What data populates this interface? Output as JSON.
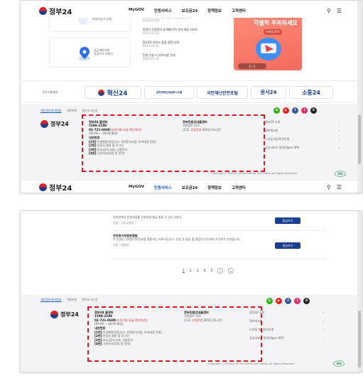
{
  "header": {
    "logo": "정부24",
    "nav": [
      "MyGOV",
      "민원서비스",
      "보조금24",
      "정책정보",
      "고객센터"
    ]
  },
  "top_section": {
    "card1_label": "부동산등기 신청",
    "card2_label": "공공개방자원\n공공누리 서비스",
    "news": [
      {
        "title": "[보건복지부] 아동수당 등 통합신청 안내",
        "date": "2024.10.23"
      },
      {
        "title": "동절기 건강관리 및 예방수칙 안내 제공 서비스",
        "date": "2024.10.22"
      },
      {
        "title": "정부24 서비스 점검 일정 안내",
        "date": "2024.10.21"
      },
      {
        "title": "민원 신청 시 유의사항 안내",
        "date": "2024.10.18"
      }
    ],
    "promo": {
      "headline": "각별히 주의하세요",
      "pill": "스미싱 문자",
      "counter": "2 / 3"
    }
  },
  "banners": {
    "label": "국민소통채널",
    "items": [
      "혁신24",
      "인터넷재산세납부시스템",
      "국민재난안전포털",
      "문서24",
      "소통24"
    ]
  },
  "footer": {
    "tabs": [
      "개인정보처리방침",
      "이용약관",
      "찾아오시는길"
    ],
    "logo": "정부24",
    "left": {
      "title": "정부24 콜센터",
      "phone1": "1588-2188",
      "phone2": "02-721-0600",
      "phone2_note": "(유료이용 요금 확인하기)",
      "hours": "(09:00 ~ 18:00 평일)",
      "guide_title": "내선번호",
      "guide": [
        {
          "key": "[1번]",
          "val": "민원행정(전입신고, 전자문서지갑, 토지대장 민원)"
        },
        {
          "key": "[2번]",
          "val": "인증서 회원 및 로그인"
        },
        {
          "key": "[3번]",
          "val": "보조금24 조회, 신청문의"
        },
        {
          "key": "[4번]",
          "val": "국민비서(알림 및 문의)"
        }
      ]
    },
    "right": {
      "title": "정부민원안내콜센터",
      "phone": "국번없이 110",
      "note_prefix": "(무료, ",
      "note_link": "휴일운영",
      "note_suffix": " 365일 24시간)"
    },
    "links": [
      "정부24 소개",
      "정보게시판",
      "누리집 개선의견신청",
      "공공서비스 정보(Open API)"
    ],
    "copyright": "Copyright ⓒ Ministry of the Interior and Safety. All Rights Reserved.",
    "sns": [
      "b",
      "▶",
      "f",
      "i",
      "X"
    ]
  },
  "second": {
    "items": [
      {
        "title": "인터넷에서 민원서류를 신청하여 발급 받을 수 있는 서비스",
        "tags": "신청 · 국토교통부"
      },
      {
        "title": "전자등기부등본열람",
        "desc": "이 민원은 전자등기부등본을 열람하는 서비스입니다. 신청 후 발급 및 열람이 가능하며 수수료가 부과됩니다.",
        "tags": "신청 · 대법원"
      }
    ],
    "apply_label": "발급하기",
    "pager": [
      "1",
      "2",
      "3",
      "4",
      "5",
      "›",
      "»"
    ]
  }
}
